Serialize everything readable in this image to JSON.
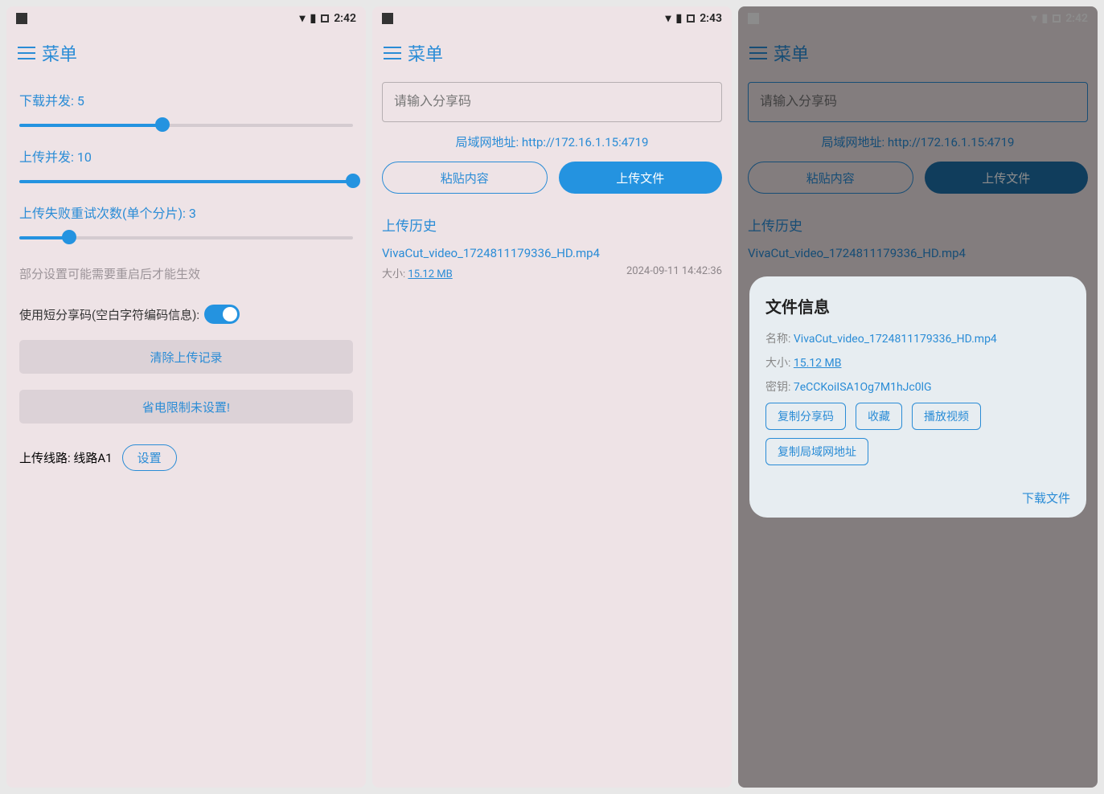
{
  "status": {
    "time1": "2:42",
    "time2": "2:43",
    "time3": "2:42"
  },
  "menu": {
    "label": "菜单"
  },
  "screen1": {
    "download_label": "下载并发: 5",
    "upload_label": "上传并发: 10",
    "retry_label": "上传失败重试次数(单个分片): 3",
    "note": "部分设置可能需要重启后才能生效",
    "shortcode_label": "使用短分享码(空白字符编码信息):",
    "clear_btn": "清除上传记录",
    "power_btn": "省电限制未设置!",
    "route_prefix": "上传线路: 线路A1",
    "settings_btn": "设置"
  },
  "screen2": {
    "input_placeholder": "请输入分享码",
    "lan_addr": "局域网地址: http://172.16.1.15:4719",
    "paste_btn": "粘贴内容",
    "upload_btn": "上传文件",
    "history_title": "上传历史",
    "history": {
      "name": "VivaCut_video_1724811179336_HD.mp4",
      "size_label": "大小:",
      "size": "15.12 MB",
      "time": "2024-09-11 14:42:36"
    }
  },
  "screen3": {
    "input_placeholder": "请输入分享码",
    "lan_addr": "局域网地址: http://172.16.1.15:4719",
    "paste_btn": "粘贴内容",
    "upload_btn": "上传文件",
    "history_title": "上传历史",
    "history_name": "VivaCut_video_1724811179336_HD.mp4",
    "dialog": {
      "title": "文件信息",
      "name_label": "名称:",
      "name": "VivaCut_video_1724811179336_HD.mp4",
      "size_label": "大小:",
      "size": "15.12 MB",
      "key_label": "密钥:",
      "key": "7eCCKoiISA1Og7M1hJc0lG",
      "copy_share": "复制分享码",
      "favorite": "收藏",
      "play_video": "播放视频",
      "copy_lan": "复制局域网地址",
      "download": "下载文件"
    }
  }
}
